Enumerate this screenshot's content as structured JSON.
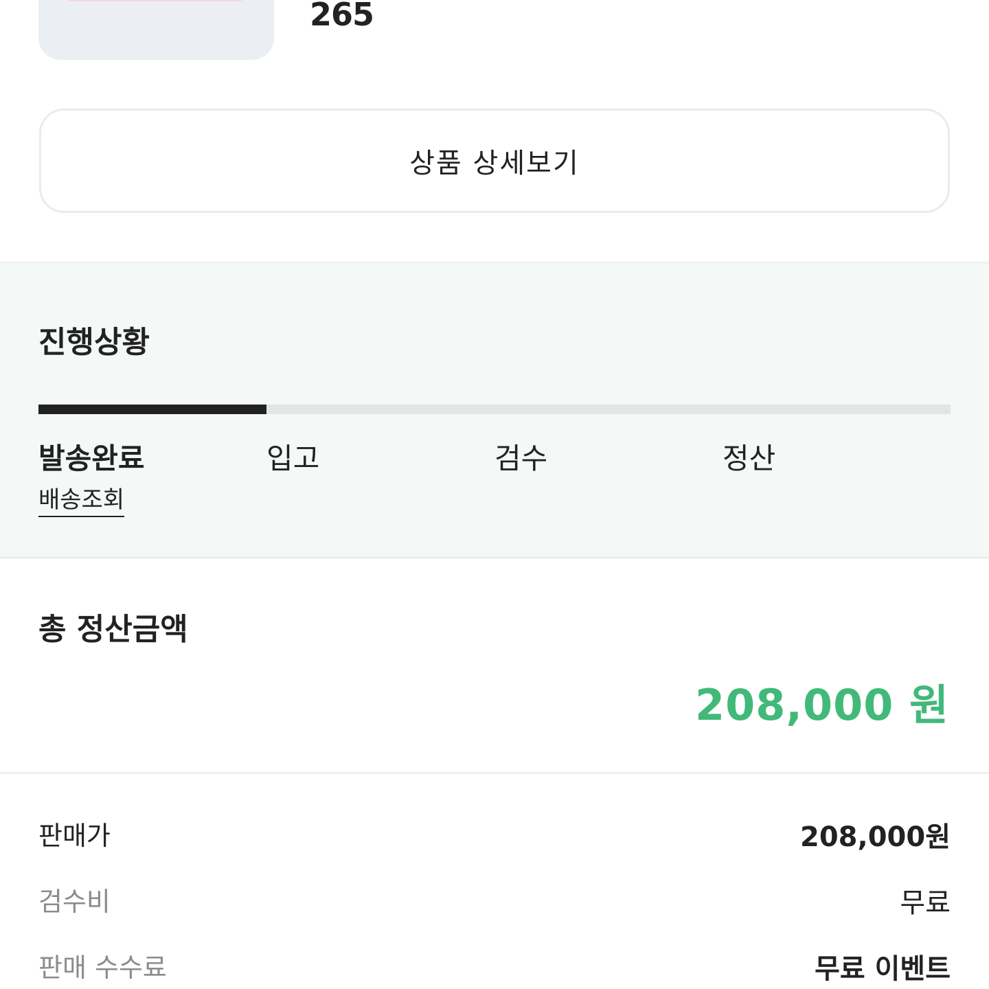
{
  "product": {
    "size": "265",
    "detail_button_label": "상품 상세보기"
  },
  "progress": {
    "title": "진행상황",
    "current_step_fraction": 0.25,
    "steps": [
      {
        "label": "발송완료",
        "active": true
      },
      {
        "label": "입고",
        "active": false
      },
      {
        "label": "검수",
        "active": false
      },
      {
        "label": "정산",
        "active": false
      }
    ],
    "tracking_link_label": "배송조회"
  },
  "total": {
    "title": "총 정산금액",
    "amount": "208,000 원",
    "accent_color": "#41b979"
  },
  "breakdown": [
    {
      "label": "판매가",
      "value": "208,000원"
    },
    {
      "label": "검수비",
      "value": "무료"
    },
    {
      "label": "판매 수수료",
      "value": "무료 이벤트"
    }
  ]
}
